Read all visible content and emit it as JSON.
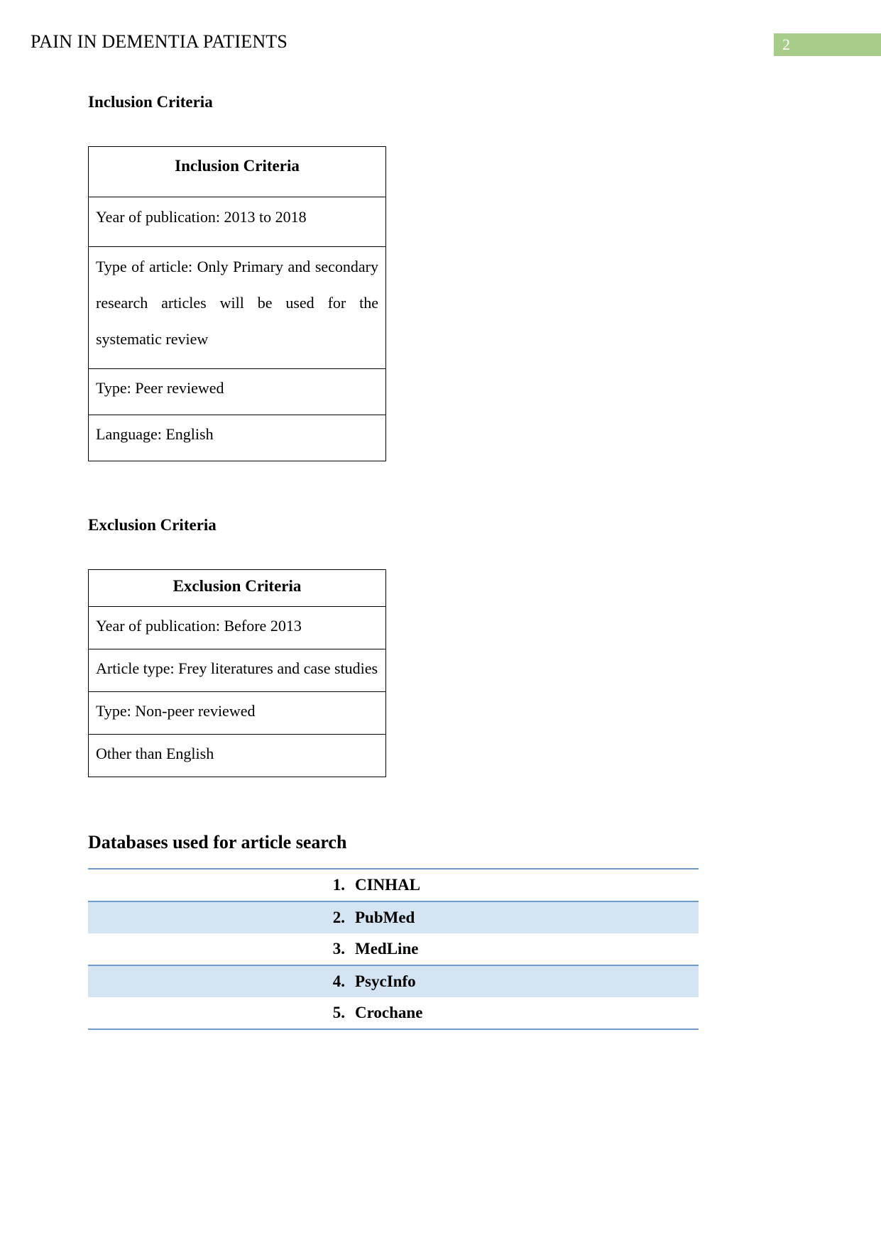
{
  "header": {
    "running_title": "PAIN IN DEMENTIA PATIENTS",
    "page_number": "2",
    "badge_color": "#a8cd8a"
  },
  "inclusion": {
    "heading": "Inclusion Criteria",
    "table": {
      "header": "Inclusion Criteria",
      "rows": [
        "Year of publication: 2013 to 2018",
        "Type of article: Only Primary and secondary research articles will be used for the systematic review",
        "Type: Peer reviewed",
        "Language: English"
      ]
    }
  },
  "exclusion": {
    "heading": "Exclusion Criteria",
    "table": {
      "header": "Exclusion Criteria",
      "rows": [
        "Year of publication: Before 2013",
        "Article type: Frey literatures and case studies",
        "Type: Non-peer reviewed",
        "Other than English"
      ]
    }
  },
  "databases": {
    "heading": "Databases used for article search",
    "border_color": "#6f9ccf",
    "shade_color": "#d5e4f2",
    "items": [
      {
        "index": "1.",
        "name": "CINHAL"
      },
      {
        "index": "2.",
        "name": "PubMed"
      },
      {
        "index": "3.",
        "name": "MedLine"
      },
      {
        "index": "4.",
        "name": "PsycInfo"
      },
      {
        "index": "5.",
        "name": "Crochane"
      }
    ]
  }
}
